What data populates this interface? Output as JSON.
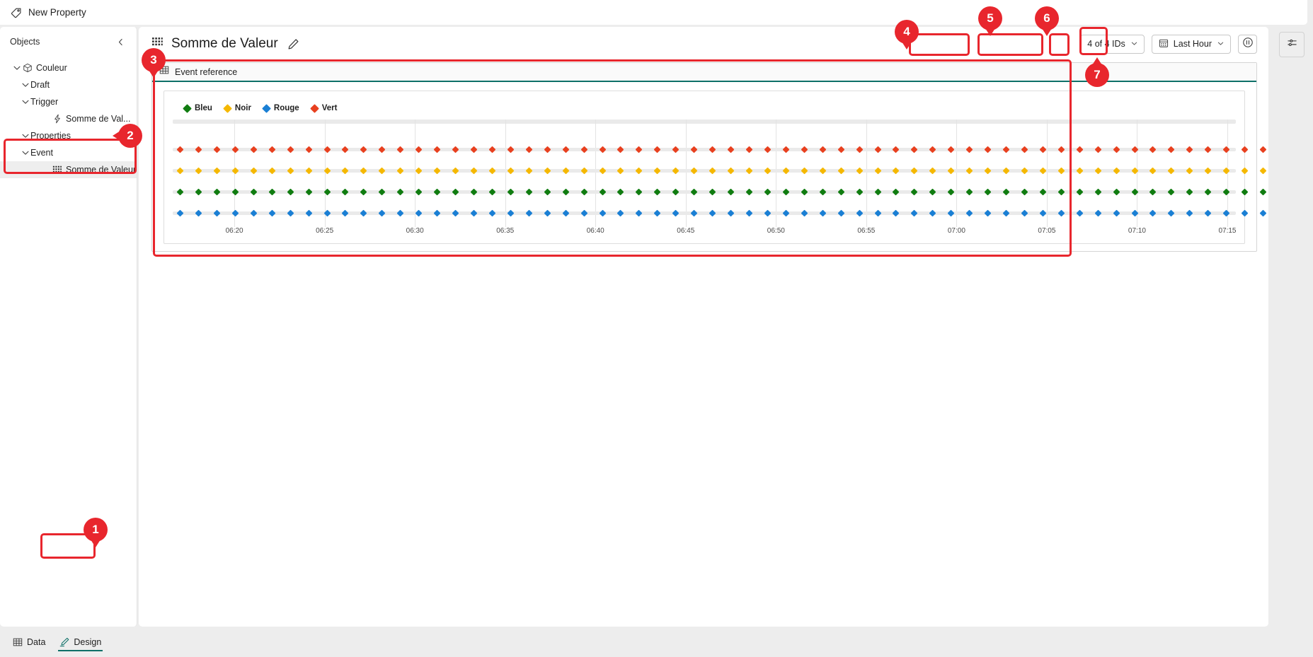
{
  "topbar": {
    "property_tab_label": "New Property",
    "property_tab_icon": "tag-icon"
  },
  "sidebar": {
    "title": "Objects",
    "collapse_icon": "chevron-left-icon",
    "tree": [
      {
        "label": "Couleur",
        "level": 0,
        "chevron": "chevron-down-icon",
        "icon": "cube-icon",
        "selected": false
      },
      {
        "label": "Draft",
        "level": 1,
        "chevron": "chevron-down-icon",
        "icon": "",
        "selected": false
      },
      {
        "label": "Trigger",
        "level": 1,
        "chevron": "chevron-down-icon",
        "icon": "",
        "selected": false
      },
      {
        "label": "Somme de Val...",
        "level": 3,
        "chevron": "",
        "icon": "lightning-icon",
        "selected": false
      },
      {
        "label": "Properties",
        "level": 1,
        "chevron": "chevron-down-icon",
        "icon": "",
        "selected": false
      },
      {
        "label": "Event",
        "level": 1,
        "chevron": "chevron-down-icon",
        "icon": "",
        "selected": false
      },
      {
        "label": "Somme de Valeur",
        "level": 3,
        "chevron": "",
        "icon": "grid-icon",
        "selected": true
      }
    ]
  },
  "bottom_tabs": [
    {
      "label": "Data",
      "icon": "table-icon",
      "active": false
    },
    {
      "label": "Design",
      "icon": "pen-icon",
      "active": true
    }
  ],
  "main": {
    "title": "Somme de Valeur",
    "title_icon": "grid-icon",
    "edit_icon": "pencil-icon",
    "toolbar": {
      "ids_filter_label": "4 of 4 IDs",
      "ids_filter_caret": "chevron-down-icon",
      "time_range_label": "Last Hour",
      "time_range_icon": "calendar-icon",
      "time_range_caret": "chevron-down-icon",
      "pause_button_icon": "pause-circle-icon"
    },
    "panel": {
      "header_label": "Event reference",
      "header_icon": "table-icon",
      "accent_color": "#0e7068"
    }
  },
  "right_rail": {
    "settings_button_icon": "sliders-icon"
  },
  "annotations": [
    {
      "number": "1",
      "target": "design-tab"
    },
    {
      "number": "2",
      "target": "event-somme-de-valeur-tree-item"
    },
    {
      "number": "3",
      "target": "event-reference-panel"
    },
    {
      "number": "4",
      "target": "ids-filter-pill"
    },
    {
      "number": "5",
      "target": "time-range-pill"
    },
    {
      "number": "6",
      "target": "pause-button"
    },
    {
      "number": "7",
      "target": "settings-rail-button"
    }
  ],
  "chart_data": {
    "type": "scatter",
    "title": "Event reference",
    "xlabel": "",
    "ylabel": "",
    "grid": true,
    "legend_position": "top-left",
    "xtick_labels": [
      "06:20",
      "06:25",
      "06:30",
      "06:35",
      "06:40",
      "06:45",
      "06:50",
      "06:55",
      "07:00",
      "07:05",
      "07:10",
      "07:15"
    ],
    "x_range": [
      "06:17",
      "07:17"
    ],
    "point_interval_minutes": 1,
    "point_count_per_series": 61,
    "series": [
      {
        "name": "Bleu",
        "color": "#107c10",
        "lane": 3,
        "marker": "diamond",
        "values_constant": 3
      },
      {
        "name": "Noir",
        "color": "#f5b800",
        "lane": 2,
        "marker": "diamond",
        "values_constant": 2
      },
      {
        "name": "Rouge",
        "color": "#1a7fd4",
        "lane": 4,
        "marker": "diamond",
        "values_constant": 4
      },
      {
        "name": "Vert",
        "color": "#e8401f",
        "lane": 1,
        "marker": "diamond",
        "values_constant": 1
      }
    ]
  }
}
